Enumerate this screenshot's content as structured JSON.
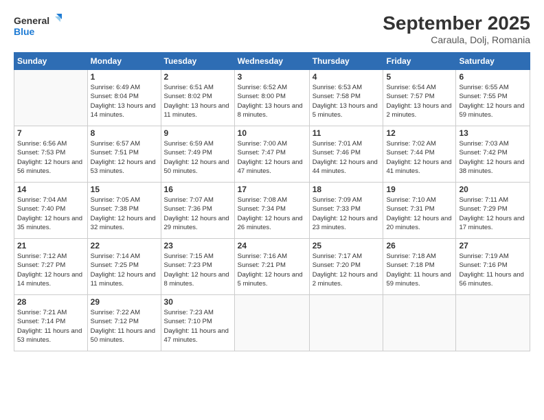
{
  "header": {
    "logo_line1": "General",
    "logo_line2": "Blue",
    "month_year": "September 2025",
    "location": "Caraula, Dolj, Romania"
  },
  "days_of_week": [
    "Sunday",
    "Monday",
    "Tuesday",
    "Wednesday",
    "Thursday",
    "Friday",
    "Saturday"
  ],
  "weeks": [
    [
      {
        "num": "",
        "empty": true
      },
      {
        "num": "1",
        "sunrise": "6:49 AM",
        "sunset": "8:04 PM",
        "daylight": "13 hours and 14 minutes."
      },
      {
        "num": "2",
        "sunrise": "6:51 AM",
        "sunset": "8:02 PM",
        "daylight": "13 hours and 11 minutes."
      },
      {
        "num": "3",
        "sunrise": "6:52 AM",
        "sunset": "8:00 PM",
        "daylight": "13 hours and 8 minutes."
      },
      {
        "num": "4",
        "sunrise": "6:53 AM",
        "sunset": "7:58 PM",
        "daylight": "13 hours and 5 minutes."
      },
      {
        "num": "5",
        "sunrise": "6:54 AM",
        "sunset": "7:57 PM",
        "daylight": "13 hours and 2 minutes."
      },
      {
        "num": "6",
        "sunrise": "6:55 AM",
        "sunset": "7:55 PM",
        "daylight": "12 hours and 59 minutes."
      }
    ],
    [
      {
        "num": "7",
        "sunrise": "6:56 AM",
        "sunset": "7:53 PM",
        "daylight": "12 hours and 56 minutes."
      },
      {
        "num": "8",
        "sunrise": "6:57 AM",
        "sunset": "7:51 PM",
        "daylight": "12 hours and 53 minutes."
      },
      {
        "num": "9",
        "sunrise": "6:59 AM",
        "sunset": "7:49 PM",
        "daylight": "12 hours and 50 minutes."
      },
      {
        "num": "10",
        "sunrise": "7:00 AM",
        "sunset": "7:47 PM",
        "daylight": "12 hours and 47 minutes."
      },
      {
        "num": "11",
        "sunrise": "7:01 AM",
        "sunset": "7:46 PM",
        "daylight": "12 hours and 44 minutes."
      },
      {
        "num": "12",
        "sunrise": "7:02 AM",
        "sunset": "7:44 PM",
        "daylight": "12 hours and 41 minutes."
      },
      {
        "num": "13",
        "sunrise": "7:03 AM",
        "sunset": "7:42 PM",
        "daylight": "12 hours and 38 minutes."
      }
    ],
    [
      {
        "num": "14",
        "sunrise": "7:04 AM",
        "sunset": "7:40 PM",
        "daylight": "12 hours and 35 minutes."
      },
      {
        "num": "15",
        "sunrise": "7:05 AM",
        "sunset": "7:38 PM",
        "daylight": "12 hours and 32 minutes."
      },
      {
        "num": "16",
        "sunrise": "7:07 AM",
        "sunset": "7:36 PM",
        "daylight": "12 hours and 29 minutes."
      },
      {
        "num": "17",
        "sunrise": "7:08 AM",
        "sunset": "7:34 PM",
        "daylight": "12 hours and 26 minutes."
      },
      {
        "num": "18",
        "sunrise": "7:09 AM",
        "sunset": "7:33 PM",
        "daylight": "12 hours and 23 minutes."
      },
      {
        "num": "19",
        "sunrise": "7:10 AM",
        "sunset": "7:31 PM",
        "daylight": "12 hours and 20 minutes."
      },
      {
        "num": "20",
        "sunrise": "7:11 AM",
        "sunset": "7:29 PM",
        "daylight": "12 hours and 17 minutes."
      }
    ],
    [
      {
        "num": "21",
        "sunrise": "7:12 AM",
        "sunset": "7:27 PM",
        "daylight": "12 hours and 14 minutes."
      },
      {
        "num": "22",
        "sunrise": "7:14 AM",
        "sunset": "7:25 PM",
        "daylight": "12 hours and 11 minutes."
      },
      {
        "num": "23",
        "sunrise": "7:15 AM",
        "sunset": "7:23 PM",
        "daylight": "12 hours and 8 minutes."
      },
      {
        "num": "24",
        "sunrise": "7:16 AM",
        "sunset": "7:21 PM",
        "daylight": "12 hours and 5 minutes."
      },
      {
        "num": "25",
        "sunrise": "7:17 AM",
        "sunset": "7:20 PM",
        "daylight": "12 hours and 2 minutes."
      },
      {
        "num": "26",
        "sunrise": "7:18 AM",
        "sunset": "7:18 PM",
        "daylight": "11 hours and 59 minutes."
      },
      {
        "num": "27",
        "sunrise": "7:19 AM",
        "sunset": "7:16 PM",
        "daylight": "11 hours and 56 minutes."
      }
    ],
    [
      {
        "num": "28",
        "sunrise": "7:21 AM",
        "sunset": "7:14 PM",
        "daylight": "11 hours and 53 minutes."
      },
      {
        "num": "29",
        "sunrise": "7:22 AM",
        "sunset": "7:12 PM",
        "daylight": "11 hours and 50 minutes."
      },
      {
        "num": "30",
        "sunrise": "7:23 AM",
        "sunset": "7:10 PM",
        "daylight": "11 hours and 47 minutes."
      },
      {
        "num": "",
        "empty": true
      },
      {
        "num": "",
        "empty": true
      },
      {
        "num": "",
        "empty": true
      },
      {
        "num": "",
        "empty": true
      }
    ]
  ],
  "labels": {
    "sunrise": "Sunrise:",
    "sunset": "Sunset:",
    "daylight": "Daylight:"
  }
}
